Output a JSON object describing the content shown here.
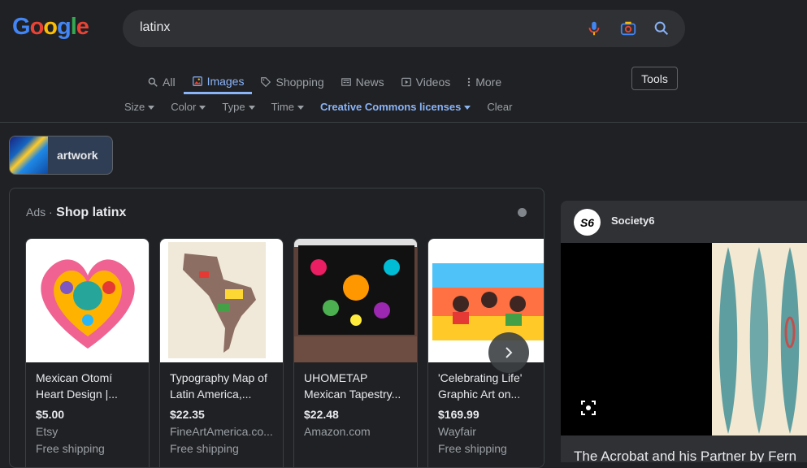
{
  "logo": {
    "text": "Google"
  },
  "search": {
    "query": "latinx"
  },
  "tabs": [
    {
      "label": "All",
      "icon": "search-icon"
    },
    {
      "label": "Images",
      "icon": "image-icon",
      "active": true
    },
    {
      "label": "Shopping",
      "icon": "tag-icon"
    },
    {
      "label": "News",
      "icon": "news-icon"
    },
    {
      "label": "Videos",
      "icon": "play-icon"
    },
    {
      "label": "More",
      "icon": "dots-vertical-icon"
    }
  ],
  "tools_label": "Tools",
  "filters": [
    {
      "label": "Size"
    },
    {
      "label": "Color"
    },
    {
      "label": "Type"
    },
    {
      "label": "Time"
    },
    {
      "label": "Creative Commons licenses",
      "highlighted": true
    },
    {
      "label": "Clear",
      "no_caret": true
    }
  ],
  "chip": {
    "label": "artwork"
  },
  "ads": {
    "prefix": "Ads ·",
    "title": "Shop latinx",
    "products": [
      {
        "title": "Mexican Otomí Heart Design |...",
        "price": "$5.00",
        "store": "Etsy",
        "shipping": "Free shipping"
      },
      {
        "title": "Typography Map of Latin America,...",
        "price": "$22.35",
        "store": "FineArtAmerica.co...",
        "shipping": "Free shipping"
      },
      {
        "title": "UHOMETAP Mexican Tapestry...",
        "price": "$22.48",
        "store": "Amazon.com",
        "shipping": ""
      },
      {
        "title": "'Celebrating Life' Graphic Art on...",
        "price": "$169.99",
        "store": "Wayfair",
        "shipping": "Free shipping"
      }
    ]
  },
  "result": {
    "source": "Society6",
    "logo_text": "S6",
    "caption": "The Acrobat and his Partner by Fern"
  },
  "colors": {
    "background": "#202124",
    "accent": "#8ab4f8",
    "searchbox": "#303134"
  }
}
